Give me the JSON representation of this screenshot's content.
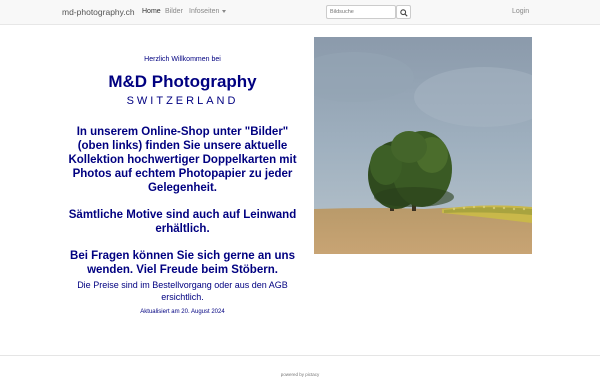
{
  "navbar": {
    "brand": "md-photography.ch",
    "items": [
      {
        "label": "Home"
      },
      {
        "label": "Bilder"
      },
      {
        "label": "Infoseiten"
      }
    ],
    "search": {
      "placeholder": "Bildsuche",
      "icon": "search-icon"
    },
    "login": "Login"
  },
  "main": {
    "welcome": "Herzlich Willkommen bei",
    "title": "M&D Photography",
    "subtitle": "SWITZERLAND",
    "para1": "In unserem Online-Shop unter \"Bilder\" (oben links) finden Sie unsere aktuelle Kollektion hochwertiger Doppelkarten mit Photos auf echtem Photopapier zu jeder Gelegenheit.",
    "para2": "Sämtliche Motive sind auch auf Leinwand erhältlich.",
    "para3": "Bei Fragen können Sie sich gerne an uns wenden. Viel Freude beim Stöbern.",
    "para4": "Die Preise sind im Bestellvorgang oder aus den AGB ersichtlich.",
    "updated": "Aktualisiert am 20. August 2024"
  },
  "footer": {
    "text": "powered by pictacy"
  },
  "colors": {
    "accent": "#000080",
    "navbar_bg": "#f8f8f8"
  }
}
